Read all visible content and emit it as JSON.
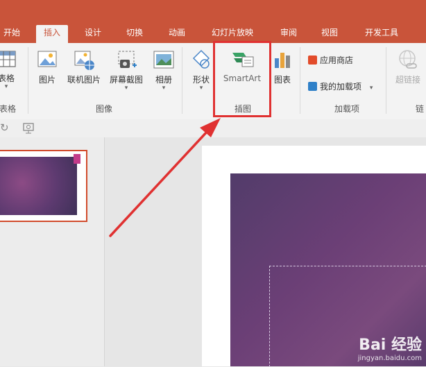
{
  "tabs": [
    {
      "label": "开始",
      "active": false
    },
    {
      "label": "插入",
      "active": true
    },
    {
      "label": "设计",
      "active": false
    },
    {
      "label": "切换",
      "active": false
    },
    {
      "label": "动画",
      "active": false
    },
    {
      "label": "幻灯片放映",
      "active": false
    },
    {
      "label": "审阅",
      "active": false
    },
    {
      "label": "视图",
      "active": false
    },
    {
      "label": "开发工具",
      "active": false
    }
  ],
  "ribbon": {
    "table": {
      "label": "表格",
      "group": "表格"
    },
    "images_group": {
      "label": "图像",
      "items": [
        "图片",
        "联机图片",
        "屏幕截图",
        "相册"
      ]
    },
    "illustrations_group": {
      "label": "插图",
      "items": [
        "形状",
        "SmartArt",
        "图表"
      ]
    },
    "addins_group": {
      "label": "加载项",
      "items": [
        "应用商店",
        "我的加载项"
      ]
    },
    "links_group": {
      "label": "链",
      "items": [
        "超链接"
      ]
    }
  },
  "watermark": {
    "brand": "Bai 经验",
    "url": "jingyan.baidu.com"
  },
  "colors": {
    "accent": "#c9543a",
    "highlight": "#e03131",
    "slide": "#6b3f76"
  }
}
